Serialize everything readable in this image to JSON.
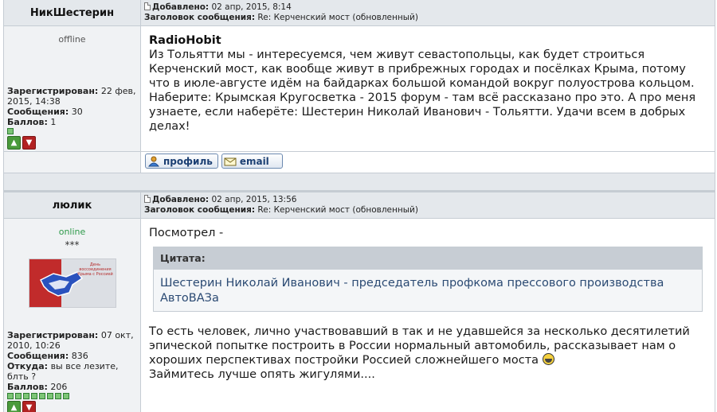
{
  "posts": [
    {
      "author": "НикШестерин",
      "status": "offline",
      "added_label": "Добавлено:",
      "added_value": "02 апр, 2015, 8:14",
      "subject_label": "Заголовок сообщения:",
      "subject_value": "Re: Керченский мост (обновленный)",
      "signature_name": "RadioHobit",
      "body": "Из Тольятти мы - интересуемся, чем живут севастопольцы, как будет строиться Керченский мост, как вообще живут в прибрежных городах и посёлках Крыма, потому что в июле-августе идём на байдарках большой командой вокруг полуострова кольцом. Наберите: Крымская Кругосветка - 2015 форум - там всё рассказано про это. А про меня узнаете, если наберёте: Шестерин Николай Иванович - Тольятти. Удачи всем в добрых делах!",
      "registered_label": "Зарегистрирован:",
      "registered_value": "22 фев, 2015, 14:38",
      "messages_label": "Сообщения:",
      "messages_value": "30",
      "points_label": "Баллов:",
      "points_value": "1",
      "profile_button": "профиль",
      "email_button": "email"
    },
    {
      "author": "люлик",
      "status": "online",
      "stars": "***",
      "added_label": "Добавлено:",
      "added_value": "02 апр, 2015, 13:56",
      "subject_label": "Заголовок сообщения:",
      "subject_value": "Re: Керченский мост (обновленный)",
      "intro": "Посмотрел -",
      "quote_label": "Цитата:",
      "quote_text": "Шестерин Николай Иванович - председатель профкома прессового производства АвтоВАЗа",
      "body": "То есть человек, лично участвовавший в так и не удавшейся за несколько десятилетий эпической попытке построить в России нормальный автомобиль, рассказывает нам о хороших перспективах постройки Россией сложнейшего моста",
      "body_end": "Займитесь лучше опять жигулями....",
      "registered_label": "Зарегистрирован:",
      "registered_value": "07 окт, 2010, 10:26",
      "messages_label": "Сообщения:",
      "messages_value": "836",
      "from_label": "Откуда:",
      "from_value": "вы все лезите, блть ?",
      "points_label": "Баллов:",
      "points_value": "206",
      "avatar_caption": "День воссоединения Крыма с Россией"
    }
  ],
  "colors": {
    "online": "#2e9a4a",
    "header_bg": "#e4e8ec",
    "quote_text": "#2b4a73"
  }
}
